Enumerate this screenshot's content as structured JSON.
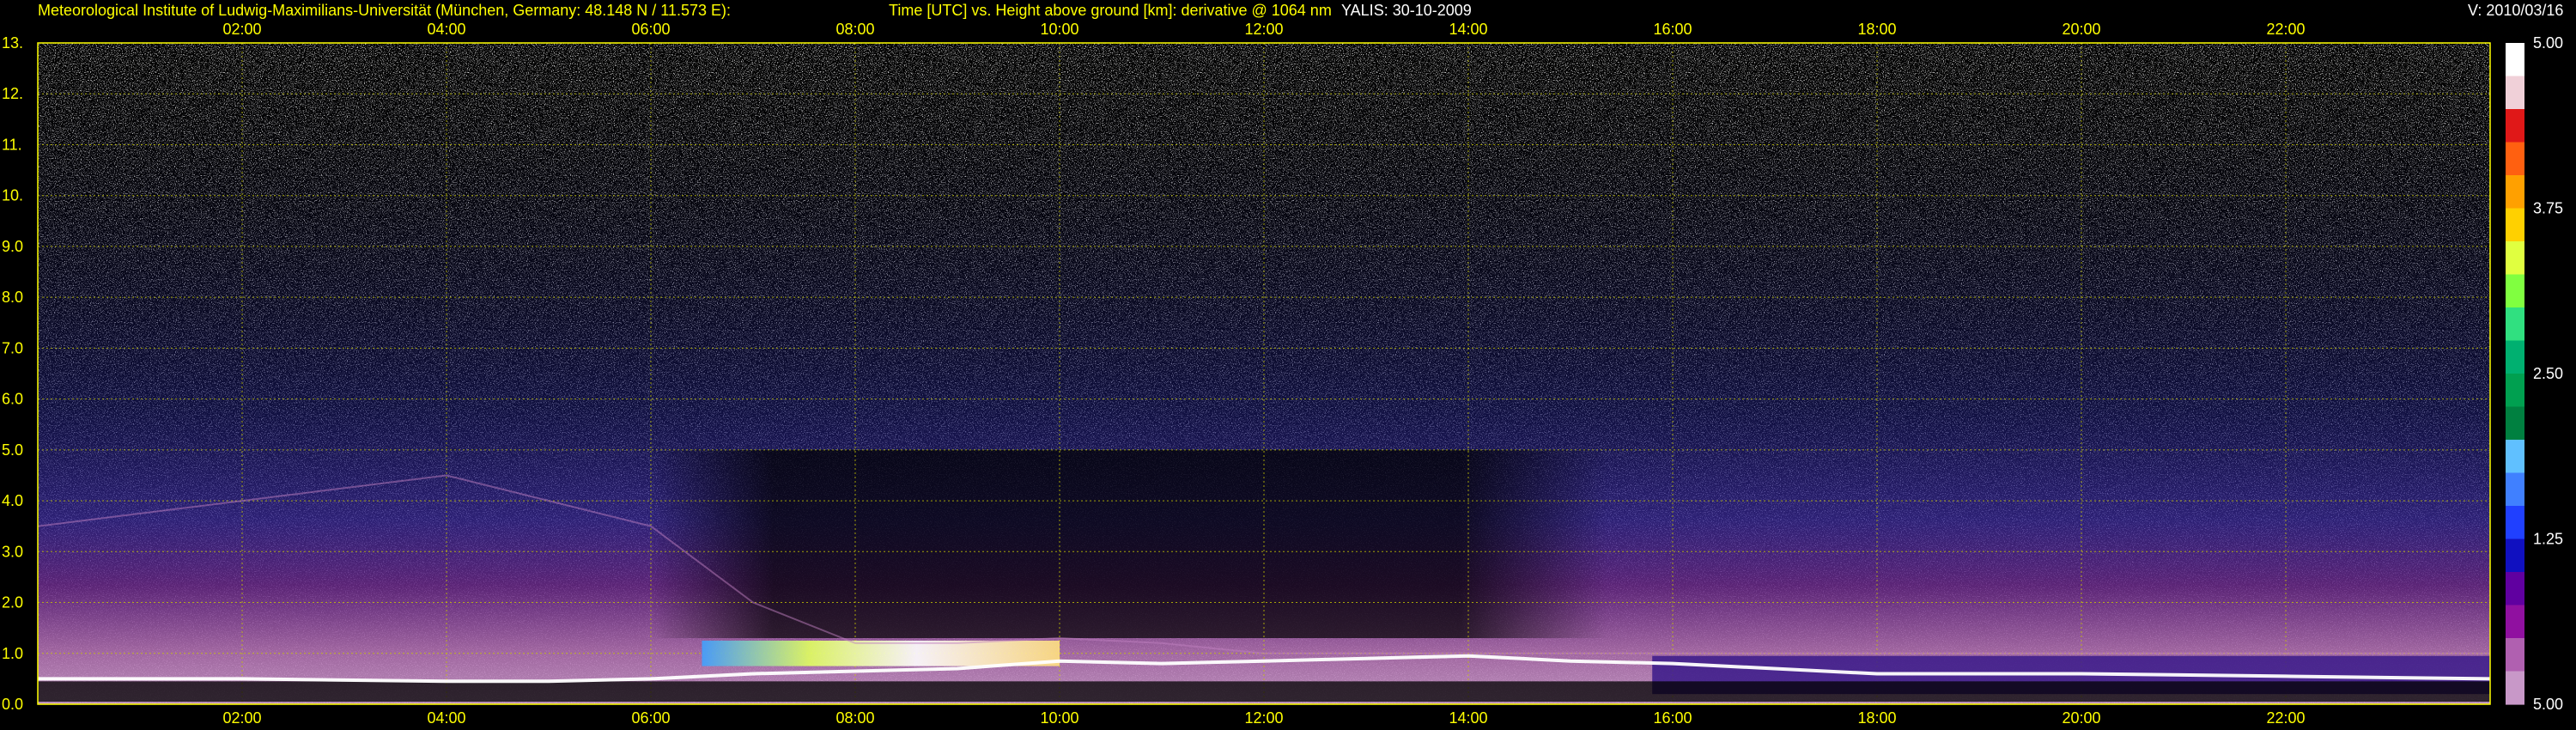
{
  "header": {
    "institute": "Meteorological Institute of Ludwig-Maximilians-Universität (München, Germany: 48.148 N / 11.573 E):",
    "axes_title": "Time [UTC] vs. Height above ground [km]: derivative @ 1064 nm",
    "station_date": "YALIS: 30-10-2009",
    "version": "V: 2010/03/16"
  },
  "colors": {
    "axis_text": "#ffff00",
    "grid": "#c8c800",
    "background": "#000000"
  },
  "chart_data": {
    "type": "heatmap",
    "title": "Time [UTC] vs. Height above ground [km]: derivative @ 1064 nm",
    "xlabel": "Time [UTC]",
    "ylabel": "Height above ground [km]",
    "xlim_hours": [
      0,
      24
    ],
    "ylim_km": [
      0,
      13
    ],
    "x_ticks": [
      "02:00",
      "04:00",
      "06:00",
      "08:00",
      "10:00",
      "12:00",
      "14:00",
      "16:00",
      "18:00",
      "20:00",
      "22:00"
    ],
    "y_ticks": [
      "0.0",
      "1.0",
      "2.0",
      "3.0",
      "4.0",
      "5.0",
      "6.0",
      "7.0",
      "8.0",
      "9.0",
      "10.",
      "11.",
      "12.",
      "13."
    ],
    "grid": true,
    "colorbar": {
      "labels": [
        "5.00",
        "3.75",
        "2.50",
        "1.25",
        "5.00"
      ],
      "colors": [
        "#ffffff",
        "#f0d0d8",
        "#e01818",
        "#ff6010",
        "#ffa000",
        "#ffd000",
        "#e0ff40",
        "#80ff40",
        "#30e080",
        "#00b070",
        "#00a050",
        "#008040",
        "#60c0ff",
        "#4080ff",
        "#2040ff",
        "#1010c0",
        "#6000a0",
        "#9010a0",
        "#b060b0",
        "#c898c8"
      ]
    },
    "features": [
      {
        "name": "boundary_layer_top_km",
        "x_hours": [
          0,
          2,
          4,
          5,
          6,
          7,
          8,
          9,
          10,
          11,
          12,
          13,
          14,
          15,
          16,
          18,
          20,
          22,
          24
        ],
        "y_km": [
          0.5,
          0.5,
          0.45,
          0.45,
          0.5,
          0.6,
          0.65,
          0.7,
          0.85,
          0.8,
          0.85,
          0.9,
          0.95,
          0.85,
          0.8,
          0.6,
          0.6,
          0.55,
          0.5
        ]
      },
      {
        "name": "aerosol_layer_top_km",
        "x_hours": [
          0,
          2,
          4,
          6,
          7,
          8,
          9,
          10,
          11,
          12,
          13,
          14,
          16,
          18,
          20,
          22,
          24
        ],
        "y_km": [
          3.5,
          4.0,
          4.5,
          3.5,
          2.0,
          1.2,
          1.2,
          1.3,
          1.2,
          1.0,
          1.0,
          1.0,
          1.0,
          1.0,
          1.0,
          1.0,
          1.0
        ]
      }
    ]
  }
}
